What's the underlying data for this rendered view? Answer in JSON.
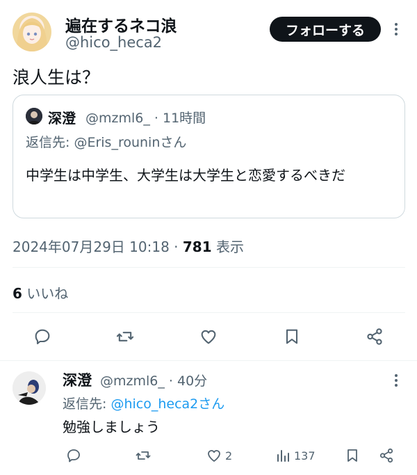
{
  "main_tweet": {
    "display_name": "遍在するネコ浪",
    "handle": "@hico_heca2",
    "follow_label": "フォローする",
    "text": "浪人生は？",
    "timestamp": "2024年07月29日 10:18",
    "views_count": "781",
    "views_label": "表示",
    "likes_count": "6",
    "likes_label": "いいね"
  },
  "quoted_tweet": {
    "display_name": "深澄",
    "handle": "@mzml6_",
    "time": "11時間",
    "reply_prefix": "返信先:",
    "reply_to": "@Eris_rouninさん",
    "text": "中学生は中学生、大学生は大学生と恋愛するべきだ"
  },
  "reply_tweet": {
    "display_name": "深澄",
    "handle": "@mzml6_",
    "time": "40分",
    "reply_prefix": "返信先:",
    "reply_to": "@hico_heca2さん",
    "text": "勉強しましょう",
    "like_count": "2",
    "view_count": "137"
  },
  "colors": {
    "text": "#0f1419",
    "muted": "#536471",
    "link": "#1d9bf0",
    "border": "#cfd9de",
    "follow_bg": "#0f1419"
  },
  "icons": [
    "more-icon",
    "reply-icon",
    "retweet-icon",
    "like-icon",
    "bookmark-icon",
    "share-icon",
    "views-icon"
  ]
}
